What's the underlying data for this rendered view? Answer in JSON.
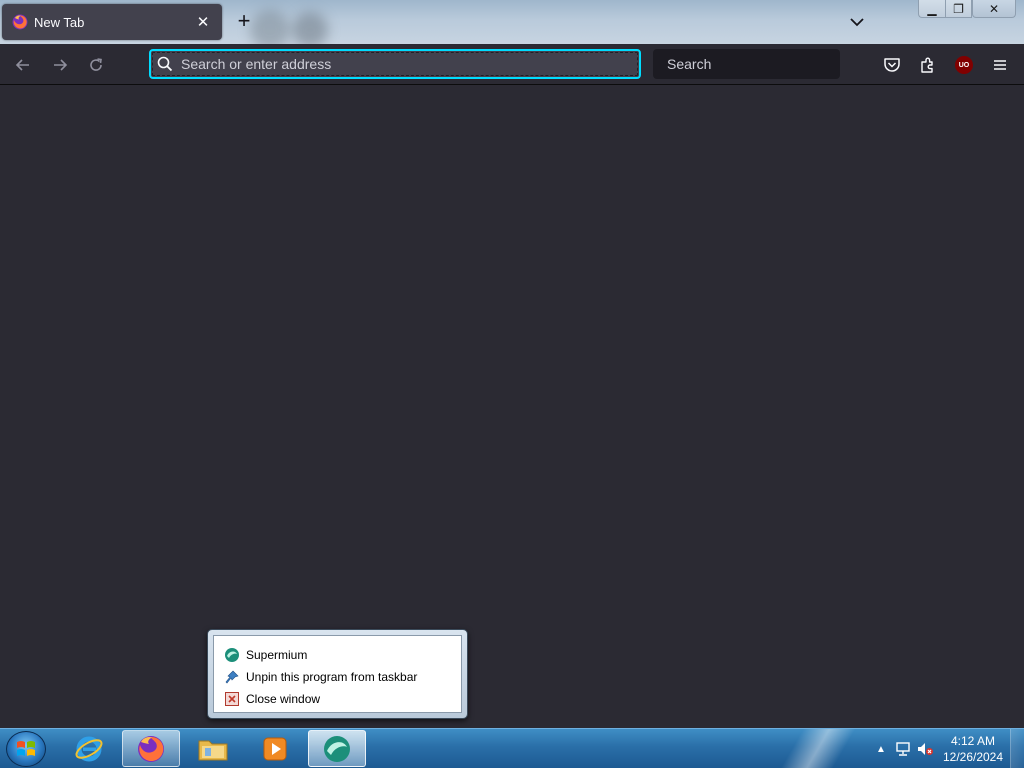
{
  "browser": {
    "tab": {
      "title": "New Tab",
      "close_glyph": "✕",
      "icon": "firefox-icon"
    },
    "new_tab_glyph": "+",
    "list_tabs_icon": "chevron-down-icon",
    "window_controls": {
      "minimize": "▁",
      "maximize": "❐",
      "close": "✕"
    }
  },
  "toolbar": {
    "back_icon": "arrow-left-icon",
    "forward_icon": "arrow-right-icon",
    "reload_icon": "reload-icon",
    "address_placeholder": "Search or enter address",
    "search_placeholder": "Search",
    "pocket_icon": "pocket-icon",
    "extensions_icon": "puzzle-icon",
    "ublock_label": "UO",
    "menu_icon": "hamburger-icon",
    "accent_color": "#00ddff"
  },
  "jump_list": {
    "items": [
      {
        "label": "Supermium",
        "icon": "supermium-icon"
      },
      {
        "label": "Unpin this program from taskbar",
        "icon": "unpin-icon"
      },
      {
        "label": "Close window",
        "icon": "close-window-icon"
      }
    ]
  },
  "taskbar": {
    "apps": [
      {
        "name": "Internet Explorer",
        "icon": "internet-explorer-icon"
      },
      {
        "name": "Firefox",
        "icon": "firefox-icon"
      },
      {
        "name": "Windows Explorer",
        "icon": "folder-icon"
      },
      {
        "name": "Media Player",
        "icon": "media-player-icon"
      },
      {
        "name": "Supermium",
        "icon": "supermium-icon"
      }
    ],
    "tray": {
      "show_hidden_glyph": "▲",
      "network_icon": "network-icon",
      "volume_icon": "volume-muted-icon"
    },
    "clock": {
      "time": "4:12 AM",
      "date": "12/26/2024"
    }
  }
}
